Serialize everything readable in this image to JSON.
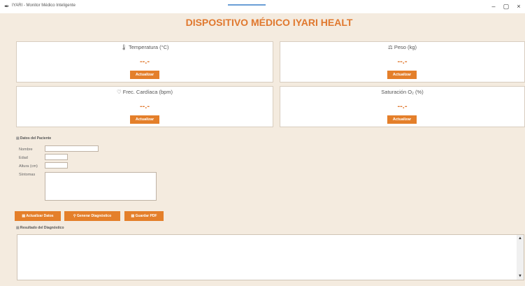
{
  "window": {
    "icon": "feather-icon",
    "title": "IYARI - Monitor Médico Inteligente",
    "minimize": "–",
    "maximize": "▢",
    "close": "×"
  },
  "app_title": "DISPOSITIVO MÉDICO IYARI HEALT",
  "cards": {
    "temp": {
      "icon": "🌡",
      "label": "Temperatura (°C)",
      "value": "--.-",
      "button": "Actualizar"
    },
    "weight": {
      "icon": "⚖",
      "label": "Peso (kg)",
      "value": "--.-",
      "button": "Actualizar"
    },
    "heart": {
      "icon": "♡",
      "label": "Frec. Cardíaca (bpm)",
      "value": "--.-",
      "button": "Actualizar"
    },
    "spo2": {
      "label": "Saturación O₂ (%)",
      "value": "--.-",
      "button": "Actualizar"
    }
  },
  "patient": {
    "section_title": "Datos del Paciente",
    "name_label": "Nombre",
    "age_label": "Edad",
    "height_label": "Altura (cm)",
    "symptoms_label": "Síntomas",
    "name_value": "",
    "age_value": "",
    "height_value": "",
    "symptoms_value": ""
  },
  "actions": {
    "update_data": "Actualizar Datos",
    "generate": "Generar Diagnóstico",
    "save_pdf": "Guardar PDF"
  },
  "result": {
    "section_title": "Resultado del Diagnóstico",
    "text": ""
  },
  "colors": {
    "accent": "#e0782e",
    "background": "#f4ebdf",
    "button": "#e47f2a"
  }
}
